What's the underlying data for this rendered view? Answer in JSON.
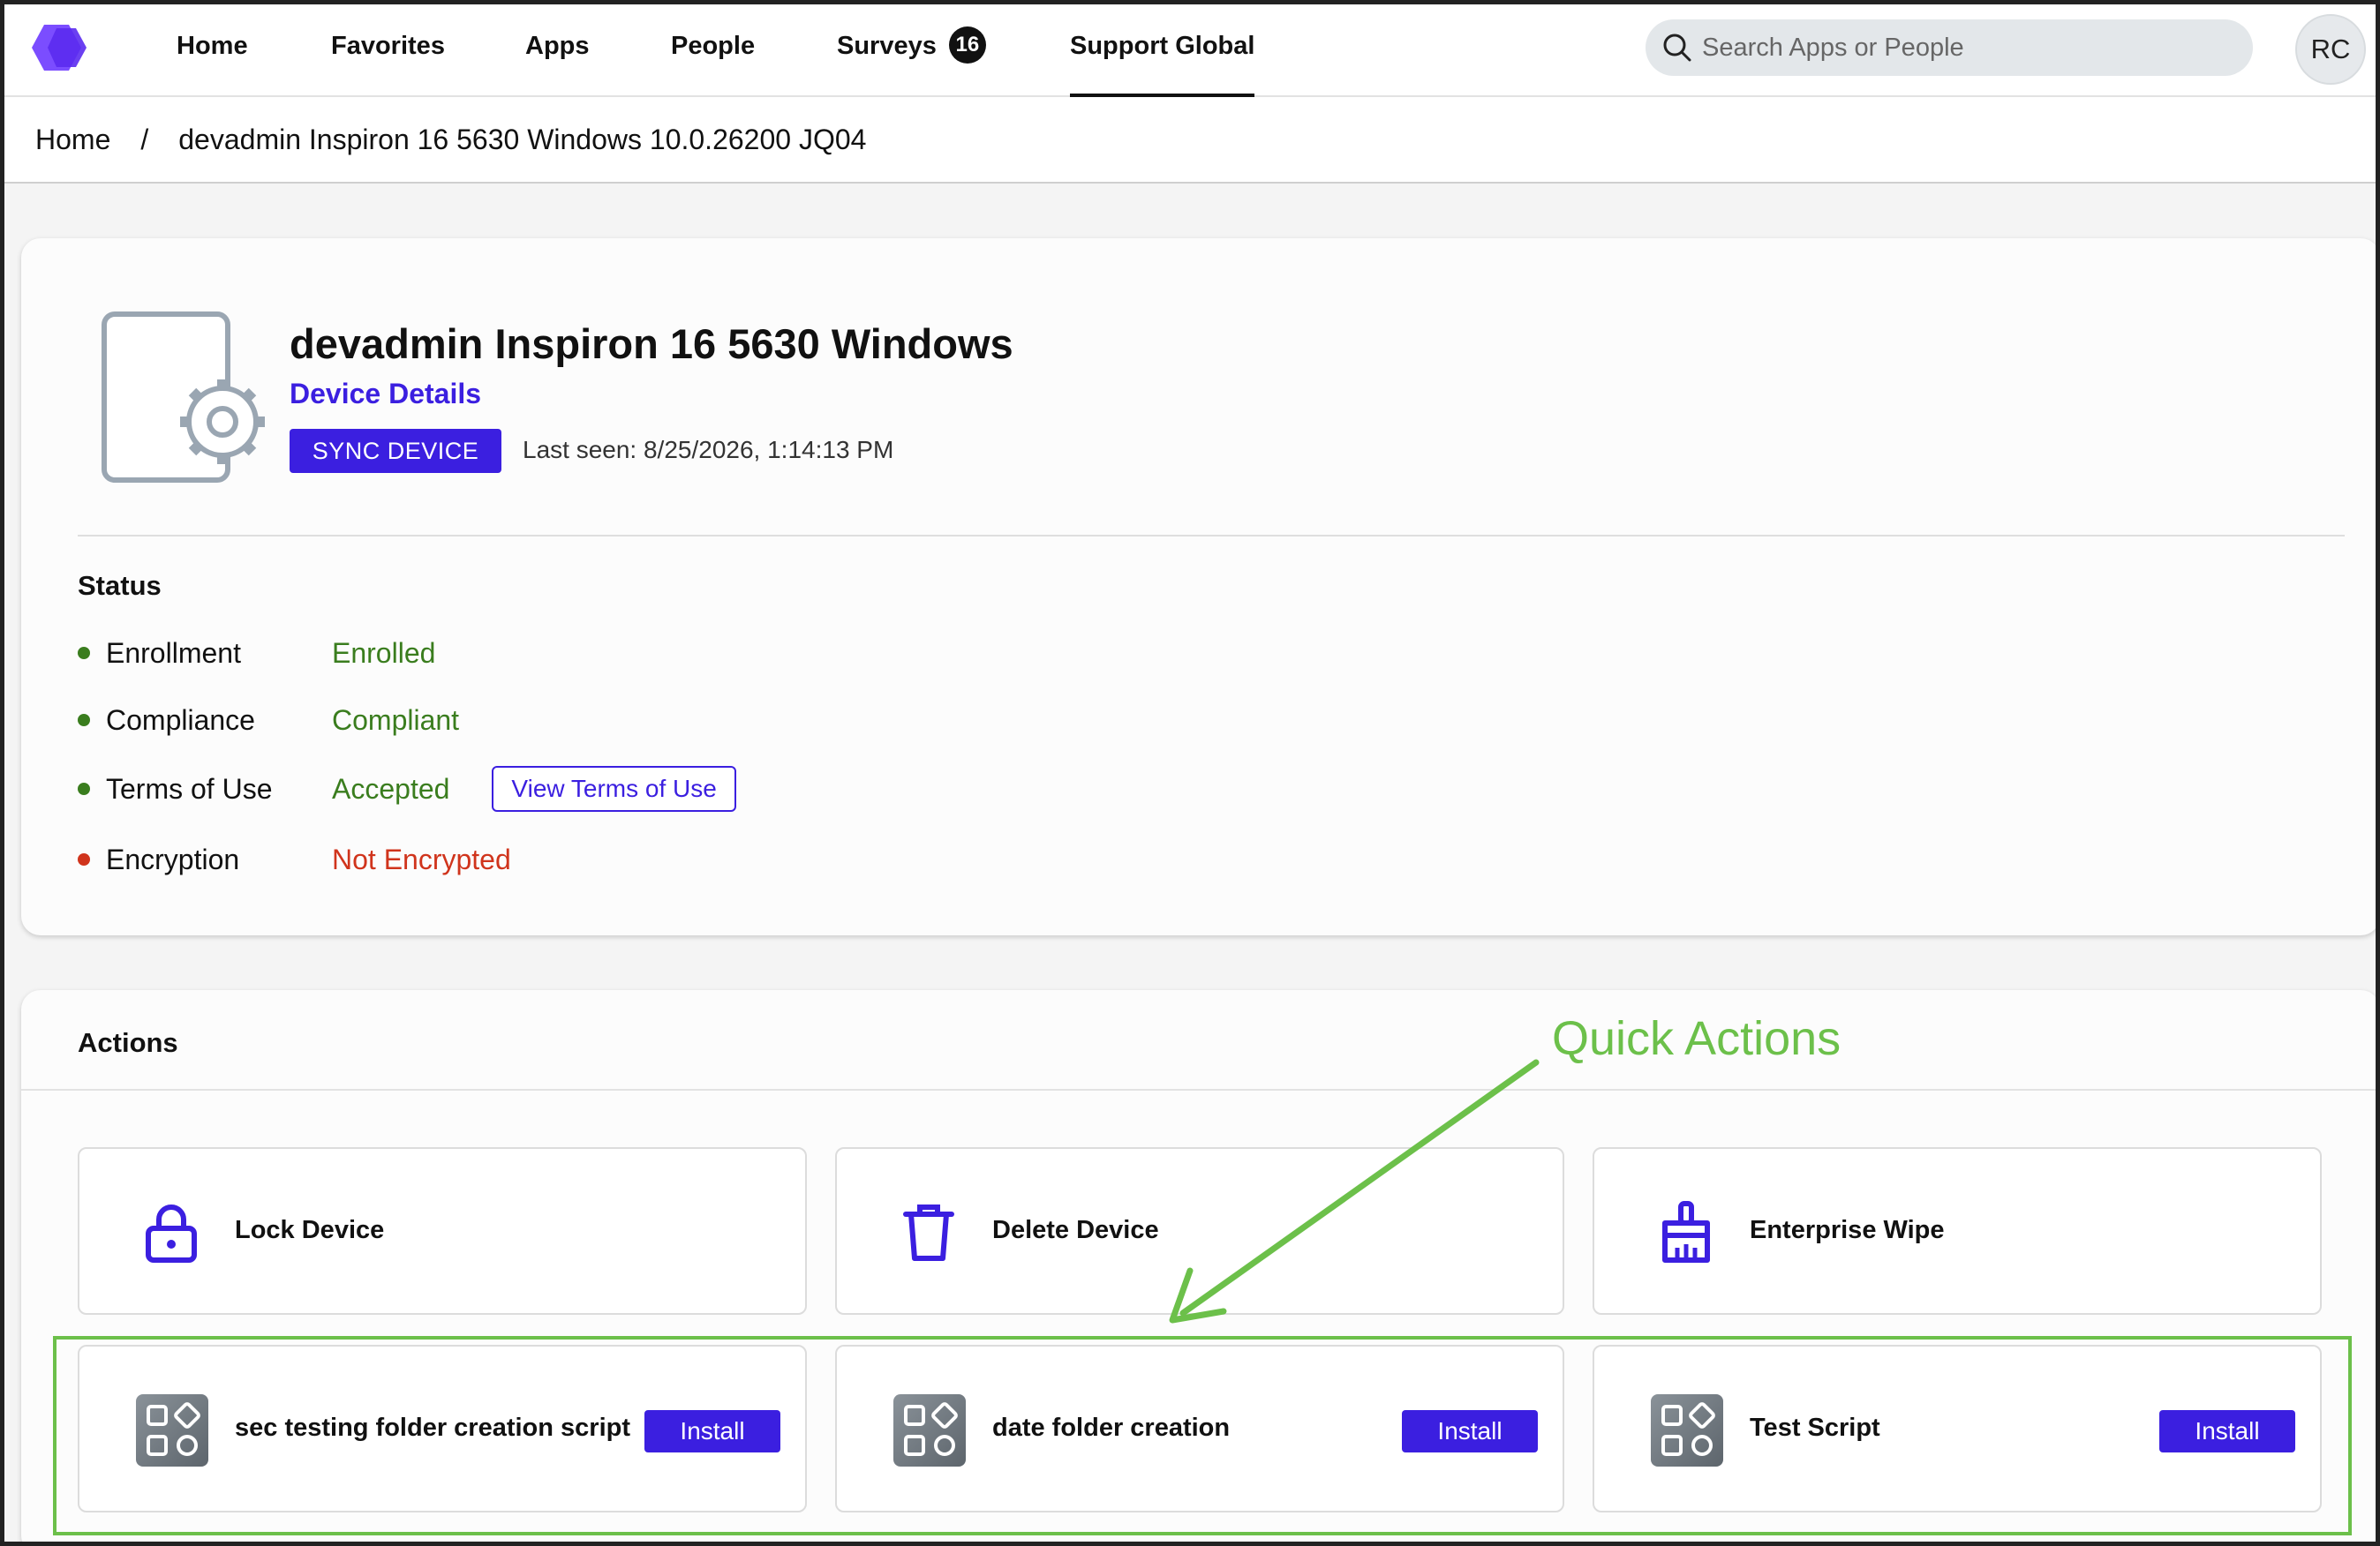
{
  "nav": {
    "items": [
      "Home",
      "Favorites",
      "Apps",
      "People",
      "Surveys",
      "Support Global"
    ],
    "surveys_badge": "16",
    "active": "Support Global",
    "search_placeholder": "Search Apps or People",
    "avatar_initials": "RC"
  },
  "breadcrumb": {
    "home": "Home",
    "separator": "/",
    "current": "devadmin Inspiron 16 5630 Windows 10.0.26200 JQ04"
  },
  "device": {
    "title": "devadmin Inspiron 16 5630 Windows",
    "subtitle": "Device Details",
    "sync_label": "SYNC DEVICE",
    "last_seen": "Last seen: 8/25/2026, 1:14:13 PM"
  },
  "status": {
    "title": "Status",
    "rows": [
      {
        "label": "Enrollment",
        "value": "Enrolled",
        "state": "good"
      },
      {
        "label": "Compliance",
        "value": "Compliant",
        "state": "good"
      },
      {
        "label": "Terms of Use",
        "value": "Accepted",
        "state": "good",
        "action": "View Terms of Use"
      },
      {
        "label": "Encryption",
        "value": "Not Encrypted",
        "state": "bad"
      }
    ]
  },
  "actions": {
    "title": "Actions",
    "tiles": [
      {
        "label": "Lock Device",
        "icon": "lock-icon"
      },
      {
        "label": "Delete Device",
        "icon": "trash-icon"
      },
      {
        "label": "Enterprise Wipe",
        "icon": "broom-icon"
      }
    ],
    "scripts": [
      {
        "label": "sec testing folder creation script",
        "button": "Install"
      },
      {
        "label": "date folder creation",
        "button": "Install"
      },
      {
        "label": "Test Script",
        "button": "Install"
      }
    ]
  },
  "annotation": {
    "label": "Quick Actions"
  },
  "colors": {
    "accent": "#3b1fe0",
    "good": "#3a7d1e",
    "bad": "#d0341c",
    "annotation": "#6cc04a"
  }
}
